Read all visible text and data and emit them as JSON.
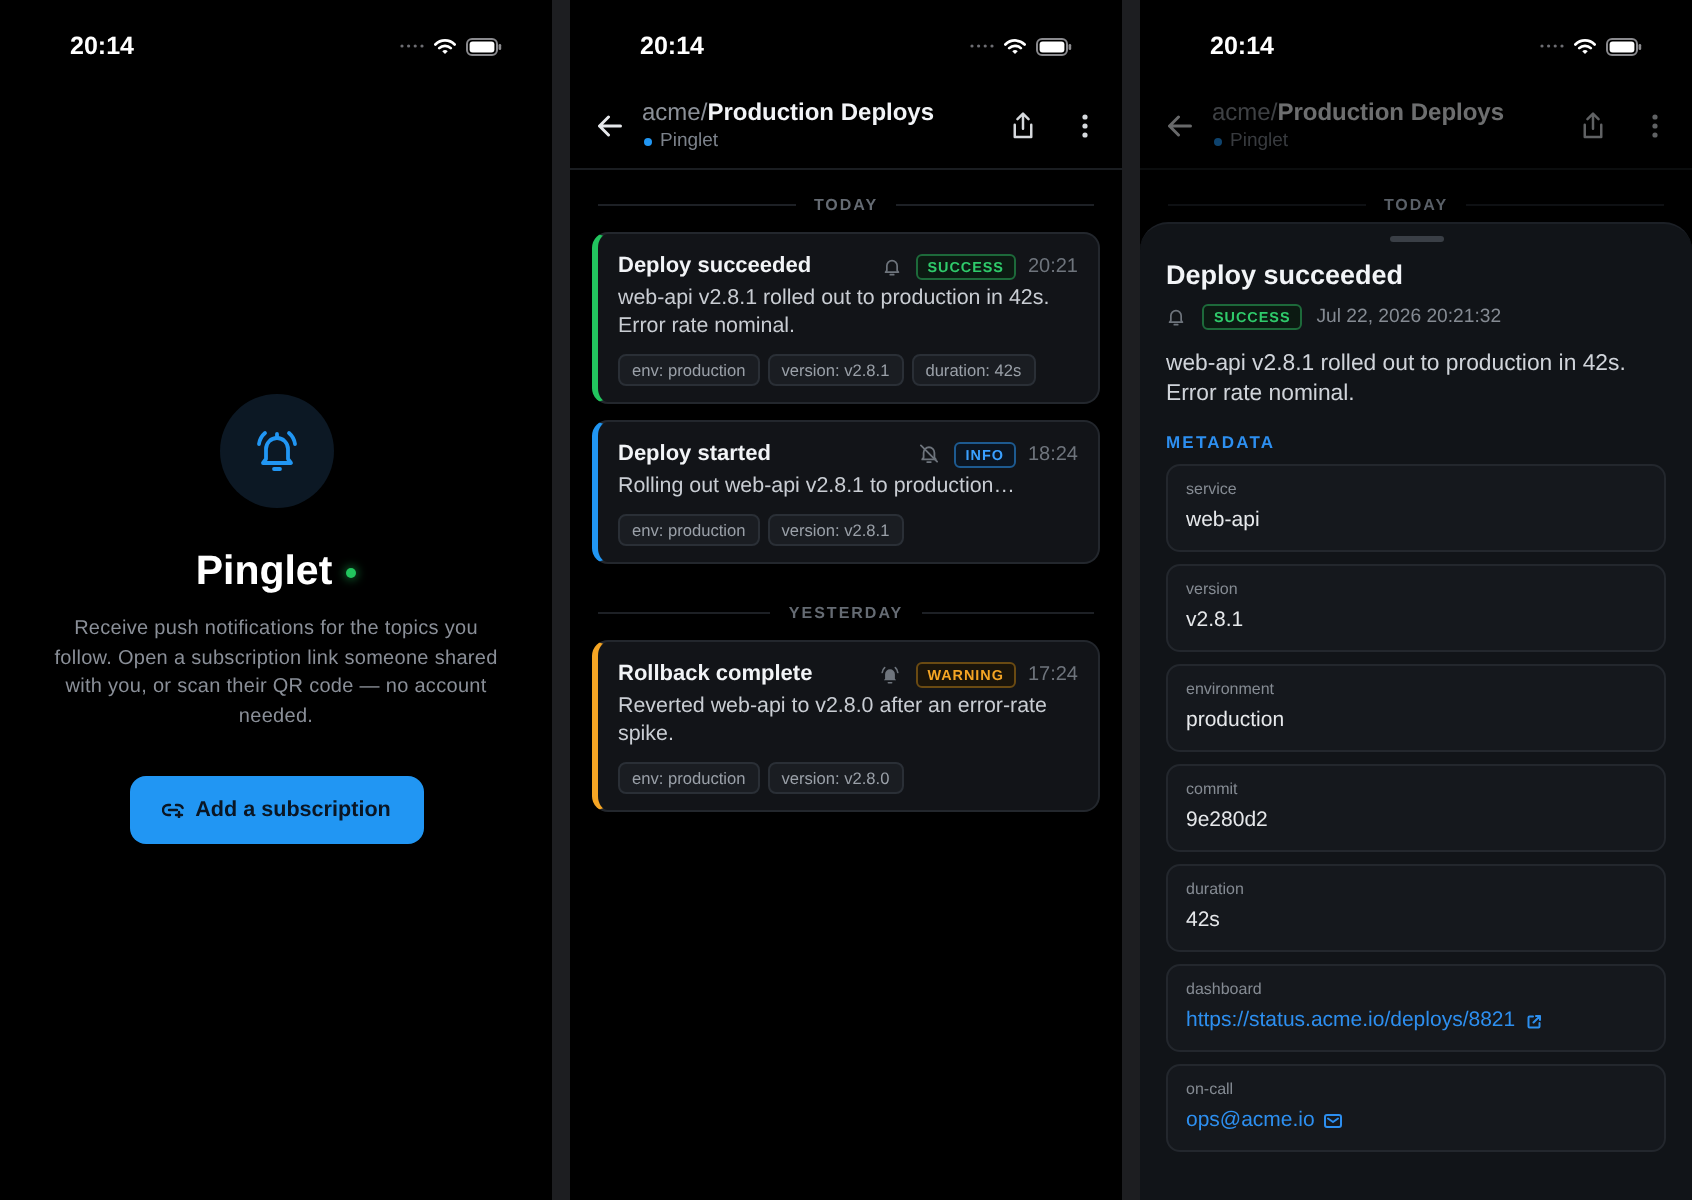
{
  "welcome_screen": {
    "status_bar": {
      "time": "20:14"
    },
    "app_name": "Pinglet",
    "online": true,
    "description": "Receive push notifications for the topics you follow. Open a subscription link someone shared with you, or scan their QR code — no account needed.",
    "button": "Add a subscription"
  },
  "topic_screen": {
    "status_bar": {
      "time": "20:14"
    },
    "header": {
      "title": "acme/**Production Deploys**",
      "source": "Pinglet"
    },
    "sections": [
      {
        "label": "TODAY",
        "notifications": [
          {
            "kind": "success",
            "title": "Deploy succeeded",
            "muted": false,
            "high_priority": false,
            "badge": "SUCCESS",
            "time": "20:21",
            "body": "web-api v2.8.1 rolled out to production in 42s. Error rate nominal.",
            "tags": [
              "env: production",
              "version: v2.8.1",
              "duration: 42s"
            ]
          },
          {
            "kind": "info",
            "title": "Deploy started",
            "muted": true,
            "high_priority": false,
            "badge": "INFO",
            "time": "18:24",
            "body": "Rolling out web-api v2.8.1 to production…",
            "tags": [
              "env: production",
              "version: v2.8.1"
            ]
          }
        ]
      },
      {
        "label": "YESTERDAY",
        "notifications": [
          {
            "kind": "warning",
            "title": "Rollback complete",
            "muted": false,
            "high_priority": true,
            "badge": "WARNING",
            "time": "17:24",
            "body": "Reverted web-api to v2.8.0 after an error-rate spike.",
            "tags": [
              "env: production",
              "version: v2.8.0"
            ]
          }
        ]
      }
    ]
  },
  "detail_screen": {
    "status_bar": {
      "time": "20:14"
    },
    "header": {
      "title": "acme/**Production Deploys**",
      "source": "Pinglet"
    },
    "section_label": "TODAY",
    "sheet": {
      "title": "Deploy succeeded",
      "kind": "success",
      "muted": false,
      "high_priority": false,
      "badge": "SUCCESS",
      "timestamp": "Jul 22, 2026 20:21:32",
      "body": "web-api v2.8.1 rolled out to production in 42s. Error rate nominal.",
      "metadata_label": "METADATA",
      "metadata": [
        {
          "key": "service",
          "value": "web-api",
          "kind": "text"
        },
        {
          "key": "version",
          "value": "v2.8.1",
          "kind": "text"
        },
        {
          "key": "environment",
          "value": "production",
          "kind": "text"
        },
        {
          "key": "commit",
          "value": "9e280d2",
          "kind": "text"
        },
        {
          "key": "duration",
          "value": "42s",
          "kind": "text"
        },
        {
          "key": "dashboard",
          "value": "https://status.acme.io/deploys/8821",
          "kind": "url"
        },
        {
          "key": "on-call",
          "value": "ops@acme.io",
          "kind": "email"
        }
      ]
    }
  }
}
